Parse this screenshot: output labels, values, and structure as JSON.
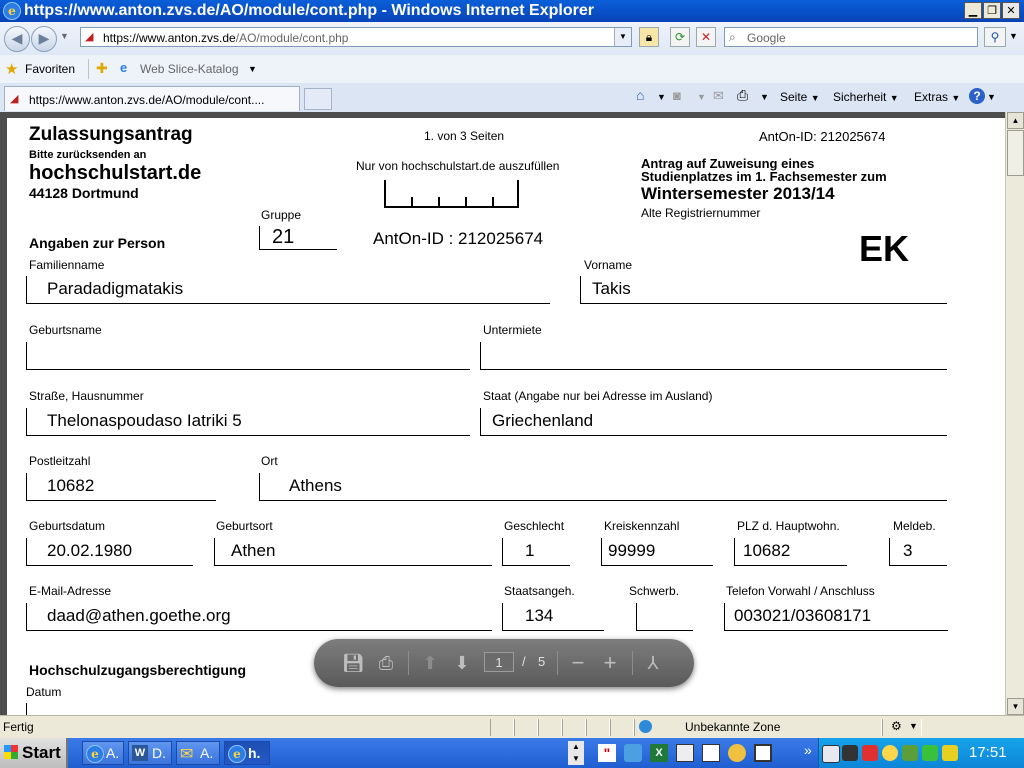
{
  "window": {
    "title": "https://www.anton.zvs.de/AO/module/cont.php - Windows Internet Explorer"
  },
  "address": {
    "url_host": "https://www.anton.zvs.de",
    "url_path": "/AO/module/cont.php",
    "search_placeholder": "Google"
  },
  "favorites": {
    "label": "Favoriten",
    "web_slice": "Web Slice-Katalog"
  },
  "tab": {
    "label": "https://www.anton.zvs.de/AO/module/cont...."
  },
  "commands": {
    "page": "Seite",
    "security": "Sicherheit",
    "extras": "Extras"
  },
  "form": {
    "title": "Zulassungsantrag",
    "return_label": "Bitte zurücksenden an",
    "org": "hochschulstart.de",
    "city": "44128 Dortmund",
    "page_info": "1. von 3 Seiten",
    "anton_id_top": "AntOn-ID: 212025674",
    "office_label": "Nur von hochschulstart.de auszufüllen",
    "antrag_line1": "Antrag auf Zuweisung eines",
    "antrag_line2": "Studienplatzes im 1. Fachsemester zum",
    "semester": "Wintersemester 2013/14",
    "alte_reg": "Alte Registriernummer",
    "gruppe_label": "Gruppe",
    "gruppe_value": "21",
    "section_person": "Angaben zur Person",
    "anton_id_mid": "AntOn-ID : 212025674",
    "code": "EK",
    "familienname_label": "Familienname",
    "familienname": "Paradadigmatakis",
    "vorname_label": "Vorname",
    "vorname": "Takis",
    "geburtsname_label": "Geburtsname",
    "geburtsname": "",
    "untermiete_label": "Untermiete",
    "untermiete": "",
    "strasse_label": "Straße, Hausnummer",
    "strasse": "Thelonaspoudaso Iatriki 5",
    "staat_label": "Staat (Angabe nur bei Adresse im Ausland)",
    "staat": "Griechenland",
    "plz_label": "Postleitzahl",
    "plz": "10682",
    "ort_label": "Ort",
    "ort": "Athens",
    "geburtsdatum_label": "Geburtsdatum",
    "geburtsdatum": "20.02.1980",
    "geburtsort_label": "Geburtsort",
    "geburtsort": "Athen",
    "geschlecht_label": "Geschlecht",
    "geschlecht": "1",
    "kreiskennzahl_label": "Kreiskennzahl",
    "kreiskennzahl": "99999",
    "plz_haupt_label": "PLZ d. Hauptwohn.",
    "plz_haupt": "10682",
    "meldeb_label": "Meldeb.",
    "meldeb": "3",
    "email_label": "E-Mail-Adresse",
    "email": "daad@athen.goethe.org",
    "staatsangeh_label": "Staatsangeh.",
    "staatsangeh": "134",
    "schwerb_label": "Schwerb.",
    "schwerb": "",
    "telefon_label": "Telefon Vorwahl / Anschluss",
    "telefon": "003021/03608171",
    "section_hzb": "Hochschulzugangsberechtigung",
    "datum_label": "Datum"
  },
  "pdf_toolbar": {
    "current_page": "1",
    "separator": "/",
    "total_pages": "5"
  },
  "status": {
    "text": "Fertig",
    "zone": "Unbekannte Zone"
  },
  "taskbar": {
    "start": "Start",
    "items": [
      "A.",
      "D.",
      "A.",
      "h."
    ],
    "clock": "17:51"
  }
}
